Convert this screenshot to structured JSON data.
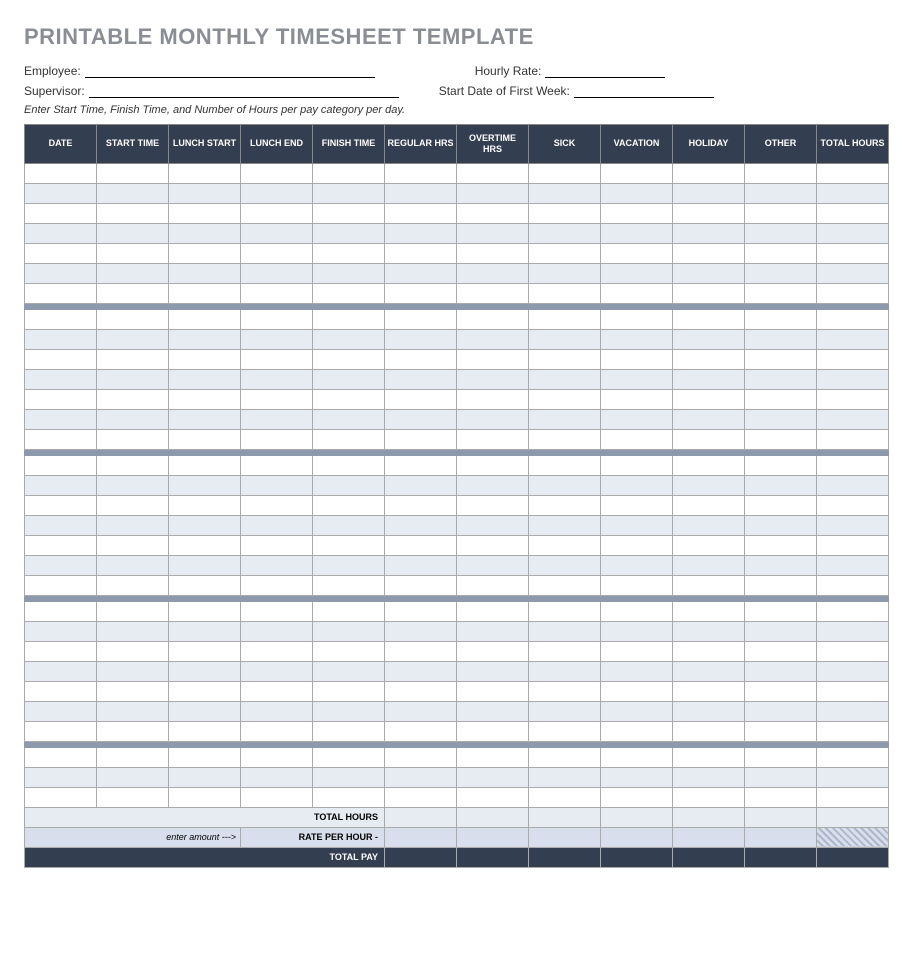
{
  "title": "PRINTABLE MONTHLY TIMESHEET TEMPLATE",
  "meta": {
    "employee_label": "Employee:",
    "hourly_rate_label": "Hourly Rate:",
    "supervisor_label": "Supervisor:",
    "start_date_label": "Start Date of First Week:"
  },
  "instructions": "Enter Start Time, Finish Time, and Number of Hours per pay category per day.",
  "columns": [
    "DATE",
    "START TIME",
    "LUNCH START",
    "LUNCH END",
    "FINISH TIME",
    "REGULAR HRS",
    "OVERTIME HRS",
    "SICK",
    "VACATION",
    "HOLIDAY",
    "OTHER",
    "TOTAL HOURS"
  ],
  "footer": {
    "total_hours_label": "TOTAL HOURS",
    "rate_prefix": "enter amount --->",
    "rate_label": "RATE PER HOUR -",
    "total_pay_label": "TOTAL PAY"
  },
  "colors": {
    "header_bg": "#333e50",
    "shaded_row": "#e7ebf2",
    "gap_row": "#8d99ac",
    "rate_row": "#d8deec"
  }
}
